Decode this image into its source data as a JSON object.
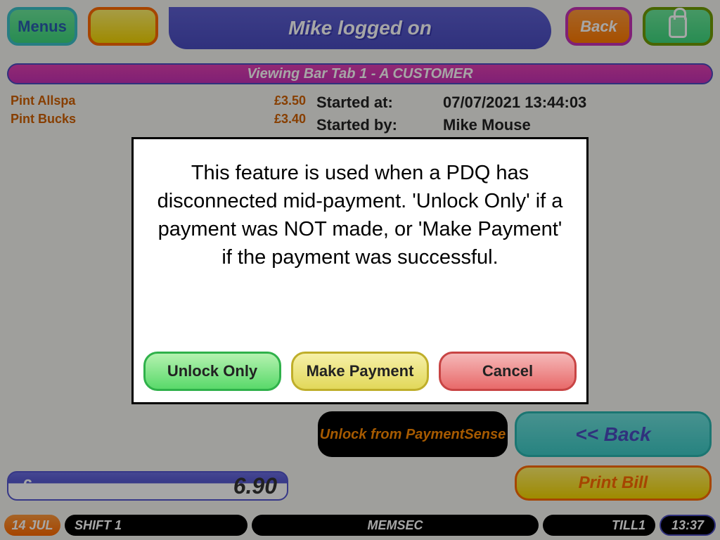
{
  "top": {
    "menus": "Menus",
    "title": "Mike logged on",
    "back": "Back"
  },
  "banner": "Viewing Bar Tab 1 - A CUSTOMER",
  "order": {
    "items": [
      {
        "name": "Pint Allspa",
        "price": "£3.50"
      },
      {
        "name": "Pint Bucks",
        "price": "£3.40"
      }
    ]
  },
  "info": {
    "started_at_label": "Started at:",
    "started_at_val": "07/07/2021 13:44:03",
    "started_by_label": "Started by:",
    "started_by_val": "Mike Mouse"
  },
  "bottom": {
    "unlock_ps": "Unlock from PaymentSense",
    "back": "<< Back",
    "print": "Print Bill",
    "currency": "£",
    "total": "6.90"
  },
  "status": {
    "date": "14 JUL",
    "shift": "SHIFT 1",
    "app": "MEMSEC",
    "till": "TILL1",
    "time": "13:37"
  },
  "modal": {
    "message": "This feature is used when a PDQ has disconnected mid-payment. 'Unlock Only' if a payment was NOT made, or 'Make Payment' if the payment was successful.",
    "unlock": "Unlock Only",
    "pay": "Make Payment",
    "cancel": "Cancel"
  }
}
